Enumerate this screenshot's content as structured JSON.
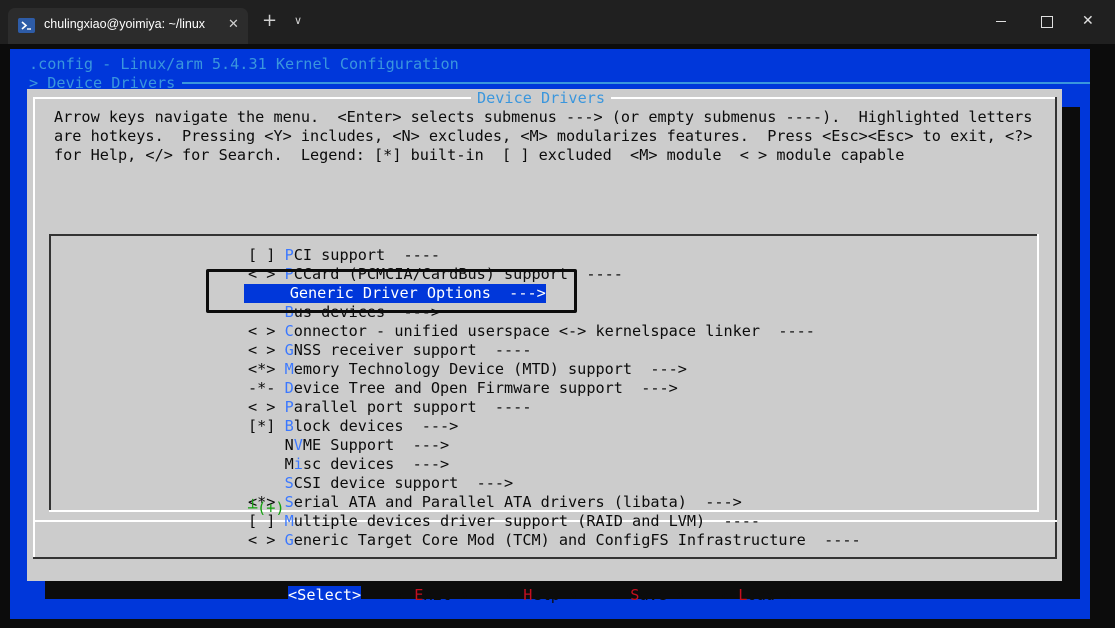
{
  "window": {
    "tab_title": "chulingxiao@yoimiya: ~/linux",
    "new_tab_symbol": "+",
    "tab_menu_symbol": "∨",
    "close_symbol": "✕"
  },
  "terminal": {
    "header_line1": ".config - Linux/arm 5.4.31 Kernel Configuration",
    "header_line2": "> Device Drivers ",
    "dialog_title": "Device Drivers",
    "help_lines": [
      "Arrow keys navigate the menu.  <Enter> selects submenus ---> (or empty submenus ----).  Highlighted letters",
      "are hotkeys.  Pressing <Y> includes, <N> excludes, <M> modularizes features.  Press <Esc><Esc> to exit, <?>",
      "for Help, </> for Search.  Legend: [*] built-in  [ ] excluded  <M> module  < > module capable"
    ],
    "menu_items": [
      {
        "prefix": "[ ] ",
        "hotkey": "P",
        "rest": "CI support  ----",
        "selected": false
      },
      {
        "prefix": "< > ",
        "hotkey": "P",
        "rest": "CCard (PCMCIA/CardBus) support  ----",
        "selected": false
      },
      {
        "prefix": "    ",
        "hotkey": "G",
        "rest": "eneric Driver Options  --->",
        "selected": true
      },
      {
        "prefix": "    ",
        "hotkey": "B",
        "rest": "us devices  --->",
        "selected": false
      },
      {
        "prefix": "< > ",
        "hotkey": "C",
        "rest": "onnector - unified userspace <-> kernelspace linker  ----",
        "selected": false
      },
      {
        "prefix": "< > ",
        "hotkey": "G",
        "rest": "NSS receiver support  ----",
        "selected": false
      },
      {
        "prefix": "<*> ",
        "hotkey": "M",
        "rest": "emory Technology Device (MTD) support  --->",
        "selected": false
      },
      {
        "prefix": "-*- ",
        "hotkey": "D",
        "rest": "evice Tree and Open Firmware support  --->",
        "selected": false
      },
      {
        "prefix": "< > ",
        "hotkey": "P",
        "rest": "arallel port support  ----",
        "selected": false
      },
      {
        "prefix": "[*] ",
        "hotkey": "B",
        "rest": "lock devices  --->",
        "selected": false
      },
      {
        "prefix": "    N",
        "hotkey": "V",
        "rest": "ME Support  --->",
        "selected": false
      },
      {
        "prefix": "    M",
        "hotkey": "i",
        "rest": "sc devices  --->",
        "selected": false
      },
      {
        "prefix": "    ",
        "hotkey": "S",
        "rest": "CSI device support  --->",
        "selected": false
      },
      {
        "prefix": "<*> ",
        "hotkey": "S",
        "rest": "erial ATA and Parallel ATA drivers (libata)  --->",
        "selected": false
      },
      {
        "prefix": "[ ] ",
        "hotkey": "M",
        "rest": "ultiple devices driver support (RAID and LVM)  ----",
        "selected": false
      },
      {
        "prefix": "< > ",
        "hotkey": "G",
        "rest": "eneric Target Core Mod (TCM) and ConfigFS Infrastructure  ----",
        "selected": false
      }
    ],
    "scroll_indicator": "┴(+)",
    "buttons": [
      {
        "pre": "<",
        "hotkey": "S",
        "post": "elect>",
        "selected": true
      },
      {
        "pre": "< ",
        "hotkey": "E",
        "post": "xit >",
        "selected": false
      },
      {
        "pre": "< ",
        "hotkey": "H",
        "post": "elp >",
        "selected": false
      },
      {
        "pre": "< ",
        "hotkey": "S",
        "post": "ave >",
        "selected": false
      },
      {
        "pre": "< ",
        "hotkey": "L",
        "post": "oad >",
        "selected": false
      }
    ]
  },
  "colors": {
    "background_blue": "#0037da",
    "dialog_gray": "#cccccc",
    "hotkey_blue": "#3b78ff",
    "button_hotkey_red": "#c50f1f",
    "scroll_green": "#13a10e"
  }
}
